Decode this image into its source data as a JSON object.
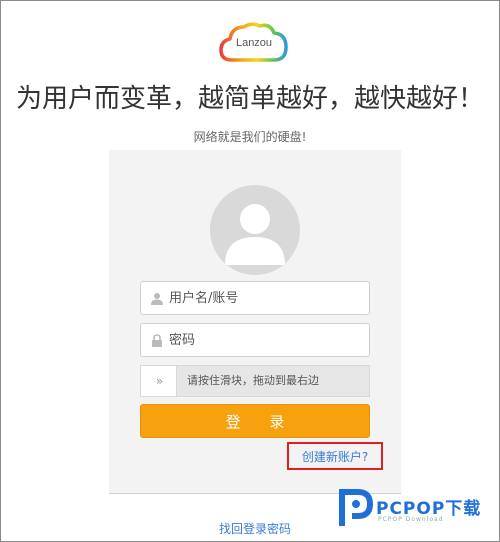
{
  "logo": {
    "text": "Lanzou"
  },
  "headline": "为用户而变革，越简单越好，越快越好！",
  "tagline": "网络就是我们的硬盘!",
  "login_form": {
    "username_placeholder": "用户名/账号",
    "password_placeholder": "密码",
    "slider_hint": "请按住滑块，拖动到最右边",
    "slider_handle_glyph": "»",
    "login_button": "登 录",
    "create_account_link": "创建新账户?",
    "recover_password_link": "找回登录密码"
  },
  "watermark": {
    "brand": "PCPOP下载",
    "sub": "PCPOP Download"
  },
  "colors": {
    "accent_orange": "#f7a10f",
    "link_blue": "#3a7bd5",
    "highlight_red": "#e02020"
  }
}
